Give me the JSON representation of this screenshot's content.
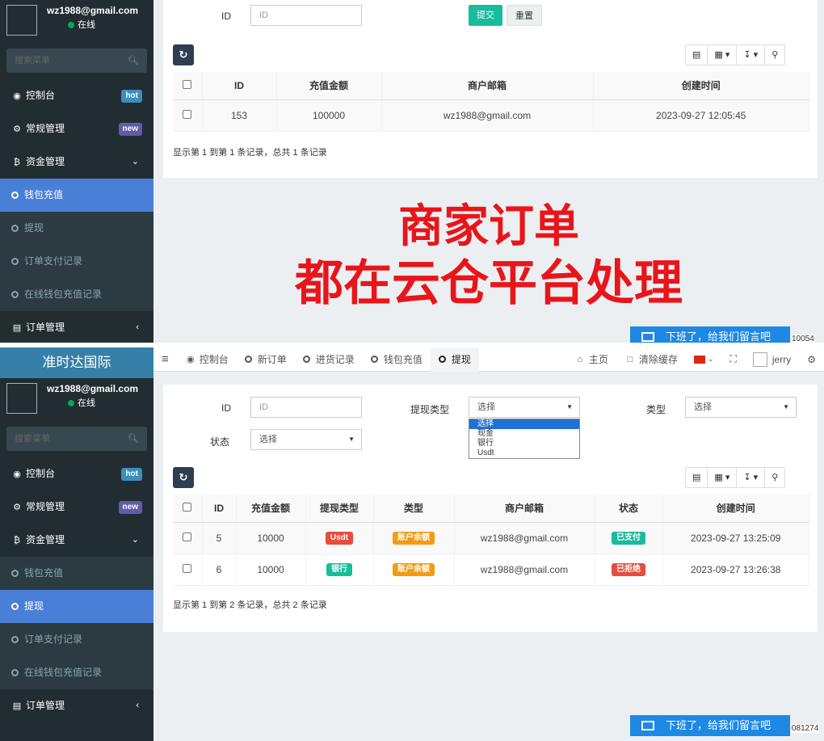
{
  "top": {
    "sidebar": {
      "user_email": "wz1988@gmail.com",
      "status": "在线",
      "search_placeholder": "搜索菜单",
      "items": [
        {
          "label": "控制台",
          "badge": "hot"
        },
        {
          "label": "常规管理",
          "badge": "new"
        },
        {
          "label": "资金管理"
        },
        {
          "label": "钱包充值"
        },
        {
          "label": "提现"
        },
        {
          "label": "订单支付记录"
        },
        {
          "label": "在线钱包充值记录"
        },
        {
          "label": "订单管理"
        }
      ]
    },
    "filter": {
      "id_label": "ID",
      "id_placeholder": "ID",
      "submit": "提交",
      "reset": "重置"
    },
    "table": {
      "headers": [
        "ID",
        "充值金额",
        "商户邮箱",
        "创建时间"
      ],
      "rows": [
        {
          "id": "153",
          "amount": "100000",
          "email": "wz1988@gmail.com",
          "created": "2023-09-27 12:05:45"
        }
      ]
    },
    "footer": "显示第 1 到第 1 条记录，总共 1 条记录",
    "overlay": {
      "line1": "商家订单",
      "line2": "都在云仓平台处理"
    },
    "chat": "下班了，给我们留言吧",
    "chat_id": "10054"
  },
  "bottom": {
    "app_title": "准时达国际",
    "sidebar": {
      "user_email": "wz1988@gmail.com",
      "status": "在线",
      "search_placeholder": "搜索菜单",
      "items": [
        {
          "label": "控制台",
          "badge": "hot"
        },
        {
          "label": "常规管理",
          "badge": "new"
        },
        {
          "label": "资金管理"
        },
        {
          "label": "钱包充值"
        },
        {
          "label": "提现"
        },
        {
          "label": "订单支付记录"
        },
        {
          "label": "在线钱包充值记录"
        },
        {
          "label": "订单管理"
        }
      ]
    },
    "navbar": {
      "tabs": [
        "控制台",
        "新订单",
        "进货记录",
        "钱包充值",
        "提现"
      ],
      "home": "主页",
      "clear_cache": "清除缓存",
      "user": "jerry"
    },
    "filter": {
      "id_label": "ID",
      "id_placeholder": "ID",
      "withdraw_type_label": "提现类型",
      "withdraw_type_value": "选择",
      "type_label": "类型",
      "type_value": "选择",
      "status_label": "状态",
      "status_value": "选择",
      "dropdown_options": [
        "选择",
        "现金",
        "银行",
        "Usdt"
      ]
    },
    "table": {
      "headers": [
        "ID",
        "充值金额",
        "提现类型",
        "类型",
        "商户邮箱",
        "状态",
        "创建时间"
      ],
      "rows": [
        {
          "id": "5",
          "amount": "10000",
          "withdraw_type": "Usdt",
          "type": "账户余额",
          "email": "wz1988@gmail.com",
          "status": "已支付",
          "created": "2023-09-27 13:25:09"
        },
        {
          "id": "6",
          "amount": "10000",
          "withdraw_type": "银行",
          "type": "账户余额",
          "email": "wz1988@gmail.com",
          "status": "已拒绝",
          "created": "2023-09-27 13:26:38"
        }
      ]
    },
    "footer": "显示第 1 到第 2 条记录，总共 2 条记录",
    "chat": "下班了，给我们留言吧",
    "chat_id": "081274"
  },
  "colors": {
    "sidebar_bg": "#222d32",
    "active_blue": "#4a7fd8",
    "overlay_red": "#e8151a",
    "success_green": "#18bc9c",
    "danger_red": "#e74c3c",
    "warning_orange": "#f39c12"
  }
}
